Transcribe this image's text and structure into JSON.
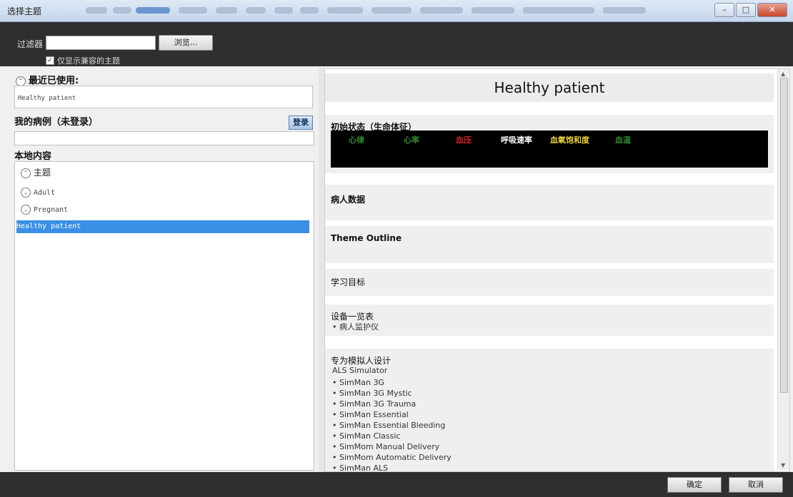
{
  "window": {
    "title": "选择主题"
  },
  "filter": {
    "label": "过滤器",
    "value": "",
    "browse_label": "浏览...",
    "compatible_label": "仅显示兼容的主题"
  },
  "recent": {
    "heading": "最近已使用:",
    "item": "Healthy patient"
  },
  "my_cases": {
    "heading": "我的病例（未登录）",
    "login_label": "登录"
  },
  "local": {
    "heading": "本地内容",
    "root_label": "主题",
    "items": [
      "Adult",
      "Pregnant"
    ],
    "selected_label": "Healthy patient"
  },
  "detail": {
    "title": "Healthy patient",
    "initial_state": {
      "heading": "初始状态（生命体征）",
      "vitals": [
        {
          "label": "心律",
          "color": "#2f8a2f"
        },
        {
          "label": "心率",
          "color": "#2f8a2f"
        },
        {
          "label": "血压",
          "color": "#d42222"
        },
        {
          "label": "呼吸速率",
          "color": "#ffffff"
        },
        {
          "label": "血氧饱和度",
          "color": "#e8d23a"
        },
        {
          "label": "血温",
          "color": "#2f8a2f"
        }
      ]
    },
    "patient_data": {
      "heading": "病人数据"
    },
    "theme_outline": {
      "heading": "Theme Outline"
    },
    "objectives": {
      "heading": "学习目标"
    },
    "equipment": {
      "heading": "设备一览表",
      "items": [
        "• 病人监护仪"
      ]
    },
    "designed_for": {
      "heading": "专为模拟人设计",
      "subtitle": "ALS Simulator",
      "items": [
        "• SimMan 3G",
        "• SimMan 3G Mystic",
        "• SimMan 3G Trauma",
        "• SimMan Essential",
        "• SimMan Essential Bleeding",
        "• SimMan Classic",
        "• SimMom Manual Delivery",
        "• SimMom Automatic Delivery",
        "• SimMan ALS"
      ]
    }
  },
  "footer": {
    "ok_label": "确定",
    "cancel_label": "取消"
  }
}
